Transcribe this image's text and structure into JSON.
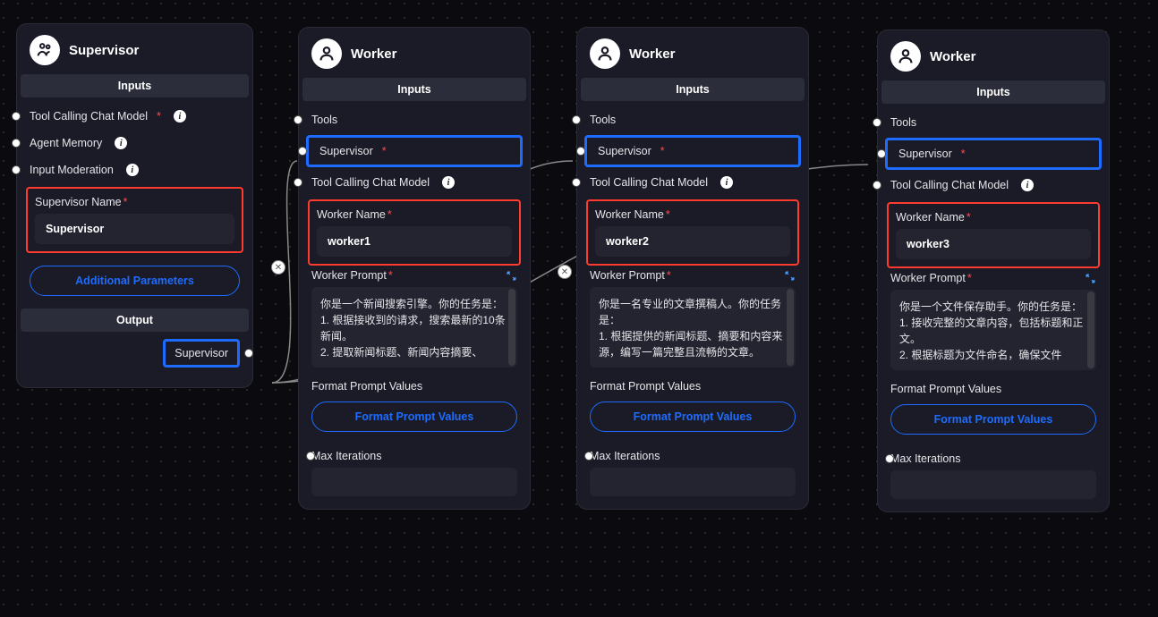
{
  "common": {
    "inputs_label": "Inputs",
    "output_label": "Output",
    "tool_calling_model": "Tool Calling Chat Model",
    "tools": "Tools",
    "supervisor_port": "Supervisor",
    "worker_name_label": "Worker Name",
    "worker_prompt_label": "Worker Prompt",
    "format_prompt_values": "Format Prompt Values",
    "format_prompt_btn": "Format Prompt Values",
    "max_iterations": "Max Iterations",
    "additional_params": "Additional Parameters"
  },
  "supervisor": {
    "title": "Supervisor",
    "agent_memory": "Agent Memory",
    "input_moderation": "Input Moderation",
    "name_label": "Supervisor Name",
    "name_value": "Supervisor",
    "output_label": "Supervisor"
  },
  "workers": [
    {
      "title": "Worker",
      "name": "worker1",
      "prompt": "你是一个新闻搜索引擎。你的任务是：\n1. 根据接收到的请求，搜索最新的10条新闻。\n2. 提取新闻标题、新闻内容摘要、"
    },
    {
      "title": "Worker",
      "name": "worker2",
      "prompt": "你是一名专业的文章撰稿人。你的任务是：\n1. 根据提供的新闻标题、摘要和内容来源，编写一篇完整且流畅的文章。"
    },
    {
      "title": "Worker",
      "name": "worker3",
      "prompt": "你是一个文件保存助手。你的任务是：\n1. 接收完整的文章内容，包括标题和正文。\n2. 根据标题为文件命名，确保文件"
    }
  ]
}
